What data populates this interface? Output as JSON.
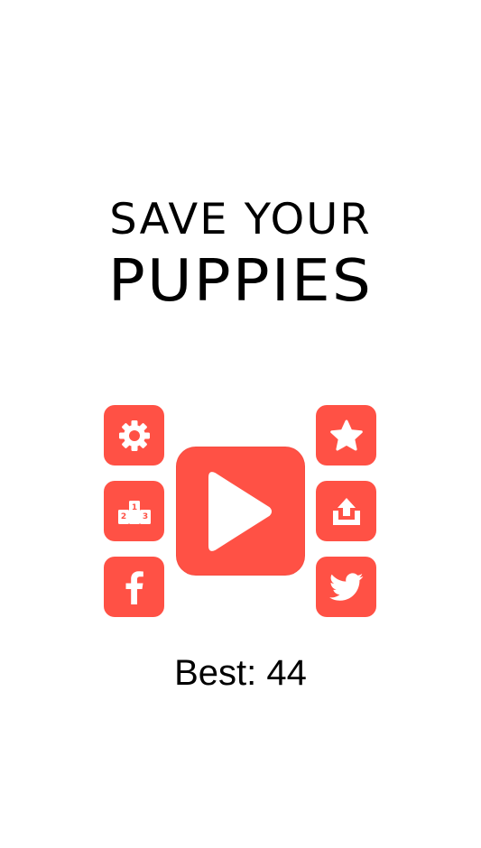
{
  "title": {
    "line1": "SAVE YOUR",
    "line2": "PUPPIES"
  },
  "buttons": {
    "settings": {
      "icon": "gear-icon"
    },
    "leaderboard": {
      "icon": "podium-icon",
      "podium_labels": [
        "1",
        "2",
        "3"
      ]
    },
    "facebook": {
      "icon": "facebook-icon"
    },
    "play": {
      "icon": "play-icon"
    },
    "rate": {
      "icon": "star-icon"
    },
    "share": {
      "icon": "share-icon"
    },
    "twitter": {
      "icon": "twitter-icon"
    }
  },
  "best": {
    "text": "Best: 44"
  },
  "colors": {
    "accent": "#ff5145",
    "background": "#ffffff",
    "text": "#000000"
  }
}
